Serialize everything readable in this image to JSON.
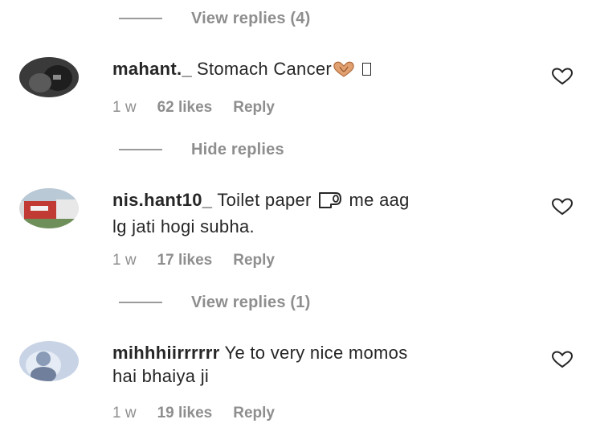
{
  "thread": {
    "top_toggle": "View replies (4)",
    "comments": [
      {
        "username": "mahant._",
        "text": "Stomach Cancer",
        "time": "1 w",
        "likes": "62 likes",
        "reply": "Reply",
        "toggle": "Hide replies"
      },
      {
        "username": "nis.hant10_",
        "text_before": "Toilet paper",
        "text_after": "me aag",
        "text_line2": "lg jati hogi subha.",
        "time": "1 w",
        "likes": "17 likes",
        "reply": "Reply",
        "toggle": "View replies (1)"
      },
      {
        "username": "mihhhiirrrrrr",
        "text_line1": "Ye to very nice momos",
        "text_line2": "hai bhaiya ji",
        "time": "1 w",
        "likes": "19 likes",
        "reply": "Reply"
      }
    ]
  },
  "icons": {
    "like": "heart-outline-icon",
    "emoji_heart_hands": "heart-hands-emoji-icon",
    "emoji_toilet_paper": "toilet-paper-emoji-icon"
  },
  "colors": {
    "text": "#262626",
    "secondary": "#8e8e8e",
    "divider": "#9a9a9a"
  }
}
